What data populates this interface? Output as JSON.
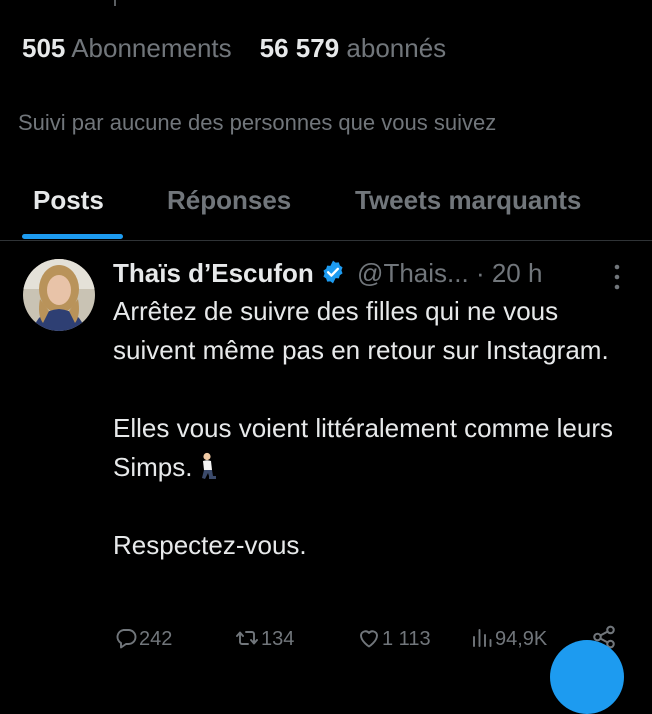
{
  "profile": {
    "following_count": "505",
    "following_label": "Abonnements",
    "followers_count": "56 579",
    "followers_label": "abonnés",
    "followed_by_text": "Suivi par aucune des personnes que vous suivez"
  },
  "tabs": [
    {
      "label": "Posts",
      "active": true
    },
    {
      "label": "Réponses",
      "active": false
    },
    {
      "label": "Tweets marquants",
      "active": false
    }
  ],
  "tweet": {
    "author_name": "Thaïs d’Escufon",
    "verified_icon": "verified-badge-icon",
    "handle": "@Thais...",
    "separator": "·",
    "time": "20 h",
    "body_lines": [
      "Arrêtez de suivre des filles qui ne vous suivent même pas en retour sur Instagram.",
      "Elles vous voient littéralement comme leurs Simps.",
      "Respectez-vous."
    ],
    "emoji_icon": "kneeling-person-emoji",
    "reply_count": "242",
    "retweet_count": "134",
    "like_count": "1 113",
    "view_count": "94,9K"
  },
  "colors": {
    "background": "#000000",
    "text_primary": "#e7e9ea",
    "text_secondary": "#71767b",
    "accent": "#1d9bf0",
    "divider": "#2f3336"
  }
}
